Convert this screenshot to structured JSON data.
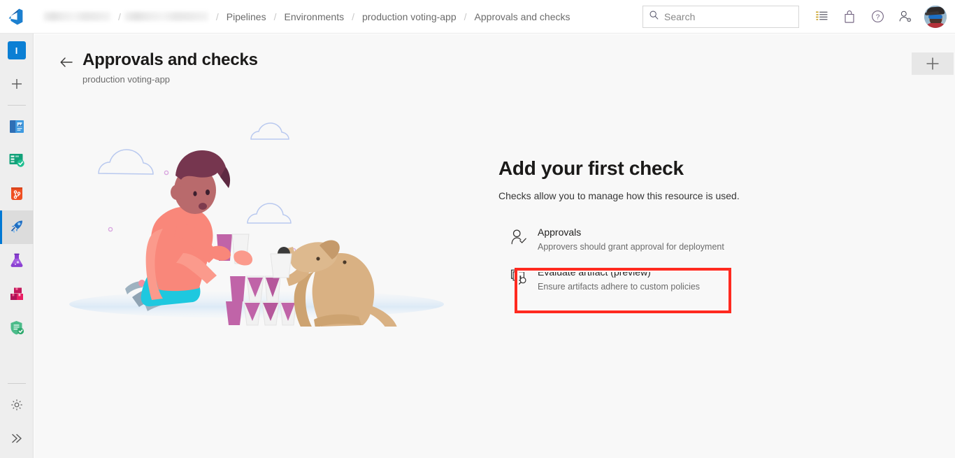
{
  "topbar": {
    "logo_icon": "azure-devops-logo",
    "breadcrumb": [
      {
        "label": "",
        "type": "blurred-org"
      },
      {
        "label": "",
        "type": "blurred-project"
      },
      {
        "label": "Pipelines",
        "type": "link"
      },
      {
        "label": "Environments",
        "type": "link"
      },
      {
        "label": "production voting-app",
        "type": "link"
      },
      {
        "label": "Approvals and checks",
        "type": "link"
      }
    ],
    "separator": "/",
    "search": {
      "placeholder": "Search",
      "icon": "search-icon"
    },
    "icons": [
      {
        "name": "boards-list-icon",
        "glyph": "list"
      },
      {
        "name": "marketplace-bag-icon",
        "glyph": "bag"
      },
      {
        "name": "help-question-icon",
        "glyph": "question"
      },
      {
        "name": "user-settings-icon",
        "glyph": "user-gear"
      }
    ],
    "avatar_alt": "user-avatar"
  },
  "rail": {
    "items": [
      {
        "name": "project-initial-tile",
        "label": "I",
        "color": "#0078d4",
        "selected": false
      },
      {
        "name": "new-item-plus",
        "label": "+",
        "selected": false
      },
      {
        "name": "overview-icon",
        "selected": false
      },
      {
        "name": "boards-icon",
        "selected": false
      },
      {
        "name": "repos-icon",
        "selected": false
      },
      {
        "name": "pipelines-icon",
        "selected": true
      },
      {
        "name": "test-plans-icon",
        "selected": false
      },
      {
        "name": "artifacts-icon",
        "selected": false
      },
      {
        "name": "advanced-security-icon",
        "selected": false
      }
    ],
    "bottom": [
      {
        "name": "project-settings-gear-icon"
      },
      {
        "name": "expand-collapse-chevrons-icon"
      }
    ]
  },
  "page": {
    "back_label": "back-arrow",
    "title": "Approvals and checks",
    "subtitle": "production voting-app",
    "add_button": "+"
  },
  "zero_state": {
    "heading": "Add your first check",
    "description": "Checks allow you to manage how this resource is used.",
    "checks": [
      {
        "icon": "approvals-person-check-icon",
        "title": "Approvals",
        "description": "Approvers should grant approval for deployment",
        "highlighted": false
      },
      {
        "icon": "evaluate-artifact-chart-search-icon",
        "title": "Evaluate artifact (preview)",
        "description": "Ensure artifacts adhere to custom policies",
        "highlighted": true
      }
    ]
  },
  "highlight": {
    "color": "#ff2a20"
  }
}
